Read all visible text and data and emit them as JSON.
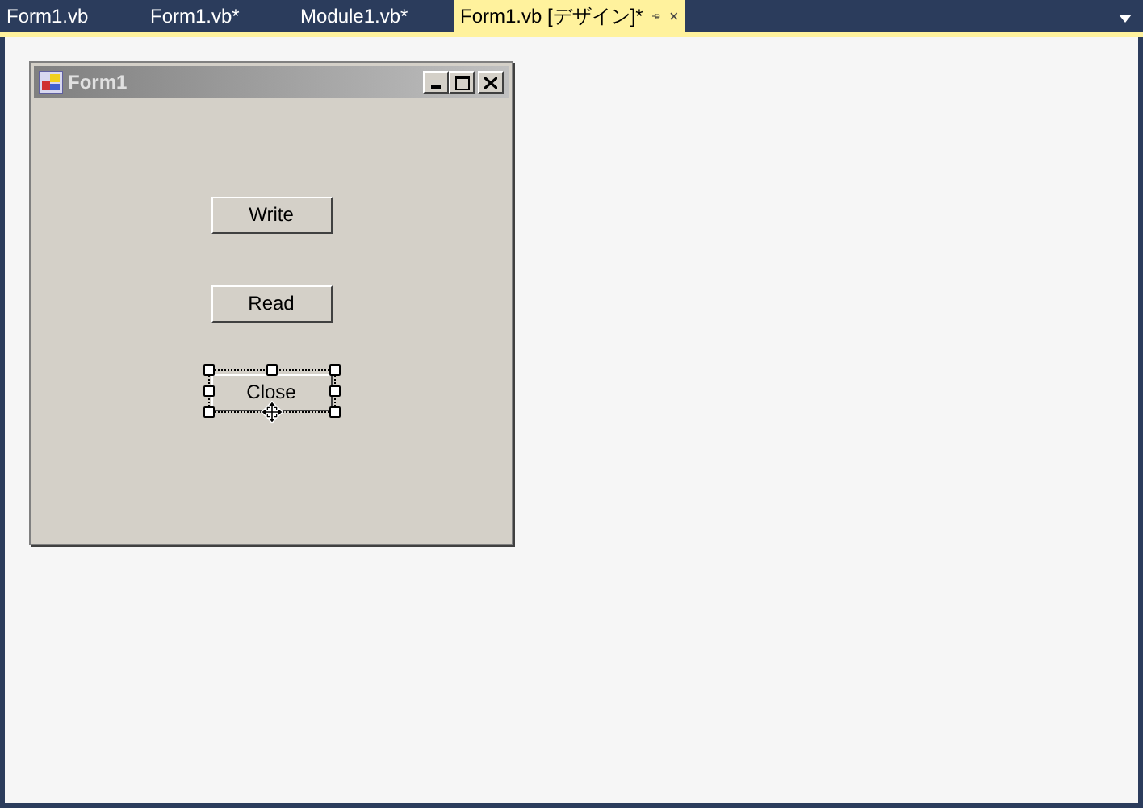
{
  "tabs": [
    {
      "label": "Form1.vb",
      "selected": false
    },
    {
      "label": "Form1.vb*",
      "selected": false
    },
    {
      "label": "Module1.vb*",
      "selected": false
    },
    {
      "label": "Form1.vb [デザイン]*",
      "selected": true
    }
  ],
  "form": {
    "title": "Form1",
    "buttons": [
      {
        "label": "Write",
        "selected": false
      },
      {
        "label": "Read",
        "selected": false
      },
      {
        "label": "Close",
        "selected": true
      }
    ]
  }
}
